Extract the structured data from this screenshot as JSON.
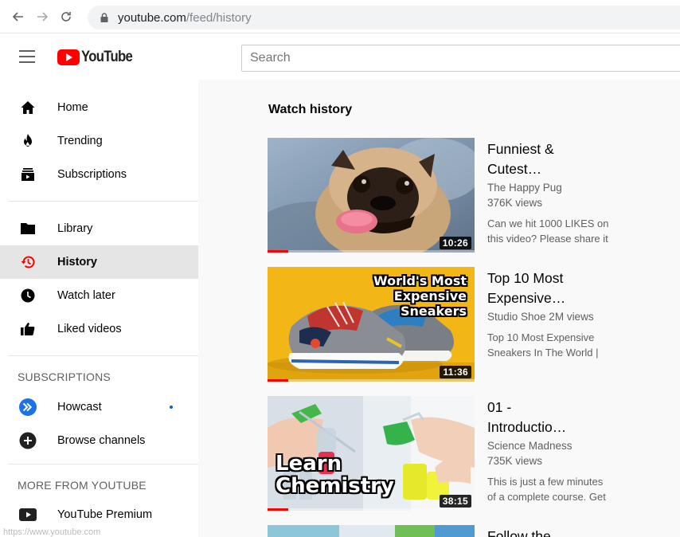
{
  "browser": {
    "url_host": "youtube.com",
    "url_path": "/feed/history"
  },
  "masthead": {
    "logo_text": "YouTube",
    "search_placeholder": "Search"
  },
  "sidebar": {
    "main": [
      {
        "label": "Home",
        "icon": "home-icon"
      },
      {
        "label": "Trending",
        "icon": "flame-icon"
      },
      {
        "label": "Subscriptions",
        "icon": "subscriptions-icon"
      }
    ],
    "library": [
      {
        "label": "Library",
        "icon": "folder-icon"
      },
      {
        "label": "History",
        "icon": "history-icon",
        "active": true
      },
      {
        "label": "Watch later",
        "icon": "clock-icon"
      },
      {
        "label": "Liked videos",
        "icon": "thumbs-up-icon"
      }
    ],
    "subscriptions_title": "SUBSCRIPTIONS",
    "subscriptions": [
      {
        "label": "Howcast",
        "icon": "howcast-avatar-icon",
        "new_content": true
      },
      {
        "label": "Browse channels",
        "icon": "plus-circle-icon"
      }
    ],
    "more_title": "MORE FROM YOUTUBE",
    "more": [
      {
        "label": "YouTube Premium",
        "icon": "youtube-premium-icon"
      }
    ]
  },
  "main": {
    "title": "Watch history",
    "videos": [
      {
        "title_line1": "Funniest &",
        "title_line2": "Cutest…",
        "channel": "The Happy Pug",
        "views": "376K views",
        "desc_line1": "Can we hit 1000 LIKES on",
        "desc_line2": "this video? Please share it",
        "duration": "10:26",
        "watched_fraction": 0.1
      },
      {
        "title_line1": "Top 10 Most",
        "title_line2": "Expensive…",
        "channel": "Studio Shoe 2M views",
        "views": "",
        "desc_line1": "Top 10 Most Expensive",
        "desc_line2": "Sneakers In The World |",
        "duration": "11:36",
        "watched_fraction": 0.1,
        "overlay_lines": [
          "World's Most",
          "Expensive",
          "Sneakers"
        ]
      },
      {
        "title_line1": "01 -",
        "title_line2": "Introductio…",
        "channel": "Science Madness",
        "views": "735K views",
        "desc_line1": "This is just a few minutes",
        "desc_line2": "of a complete course. Get",
        "duration": "38:15",
        "watched_fraction": 0.1,
        "overlay_lines": [
          "Learn",
          "Chemistry"
        ]
      },
      {
        "title_line1": "Follow the",
        "title_line2": ""
      }
    ]
  },
  "status_url": "https://www.youtube.com",
  "colors": {
    "brand_red": "#ff0000",
    "active_bg": "#e5e5e5",
    "main_bg": "#f9f9f9",
    "dot_blue": "#065fd4"
  }
}
